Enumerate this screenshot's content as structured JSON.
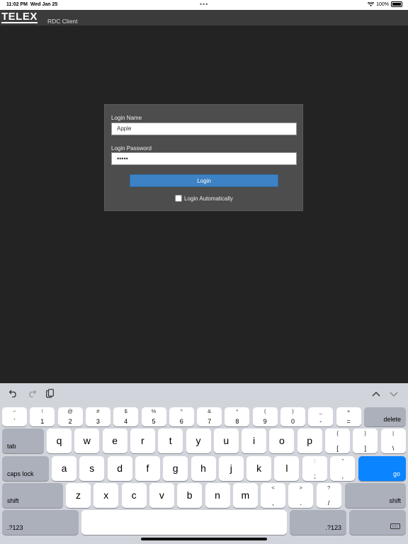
{
  "status_bar": {
    "time": "11:02 PM",
    "date": "Wed Jan 25",
    "battery": "100%"
  },
  "app": {
    "logo": "TELEX",
    "subtitle": "RDC Client"
  },
  "login": {
    "name_label": "Login Name",
    "name_value": "Apple",
    "password_label": "Login Password",
    "password_value": "•••••",
    "login_button": "Login",
    "auto_label": "Login Automatically"
  },
  "keyboard": {
    "toolbar": {
      "undo_icon": "undo-icon",
      "redo_icon": "redo-icon",
      "paste_icon": "paste-icon",
      "up_icon": "chevron-up-icon",
      "down_icon": "chevron-down-icon"
    },
    "num_row": [
      {
        "t": "~",
        "b": "`"
      },
      {
        "t": "!",
        "b": "1"
      },
      {
        "t": "@",
        "b": "2"
      },
      {
        "t": "#",
        "b": "3"
      },
      {
        "t": "$",
        "b": "4"
      },
      {
        "t": "%",
        "b": "5"
      },
      {
        "t": "^",
        "b": "6"
      },
      {
        "t": "&",
        "b": "7"
      },
      {
        "t": "*",
        "b": "8"
      },
      {
        "t": "(",
        "b": "9"
      },
      {
        "t": ")",
        "b": "0"
      },
      {
        "t": "_",
        "b": "-"
      },
      {
        "t": "+",
        "b": "="
      }
    ],
    "delete": "delete",
    "tab": "tab",
    "row_q": [
      "q",
      "w",
      "e",
      "r",
      "t",
      "y",
      "u",
      "i",
      "o",
      "p"
    ],
    "row_q_extra": [
      {
        "t": "{",
        "b": "["
      },
      {
        "t": "}",
        "b": "]"
      },
      {
        "t": "|",
        "b": "\\"
      }
    ],
    "caps": "caps lock",
    "row_a": [
      "a",
      "s",
      "d",
      "f",
      "g",
      "h",
      "j",
      "k",
      "l"
    ],
    "row_a_extra": [
      {
        "t": ":",
        "b": ";"
      },
      {
        "t": "\"",
        "b": ","
      }
    ],
    "go": "go",
    "shift": "shift",
    "row_z": [
      "z",
      "x",
      "c",
      "v",
      "b",
      "n",
      "m"
    ],
    "row_z_extra": [
      {
        "t": "<",
        "b": ","
      },
      {
        "t": ">",
        "b": "."
      },
      {
        "t": "?",
        "b": "/"
      }
    ],
    "num_switch": ".?123",
    "keyboard_icon": "keyboard-hide-icon"
  },
  "colors": {
    "accent": "#3d82c4",
    "go_key": "#0a84ff",
    "background": "#232323"
  }
}
